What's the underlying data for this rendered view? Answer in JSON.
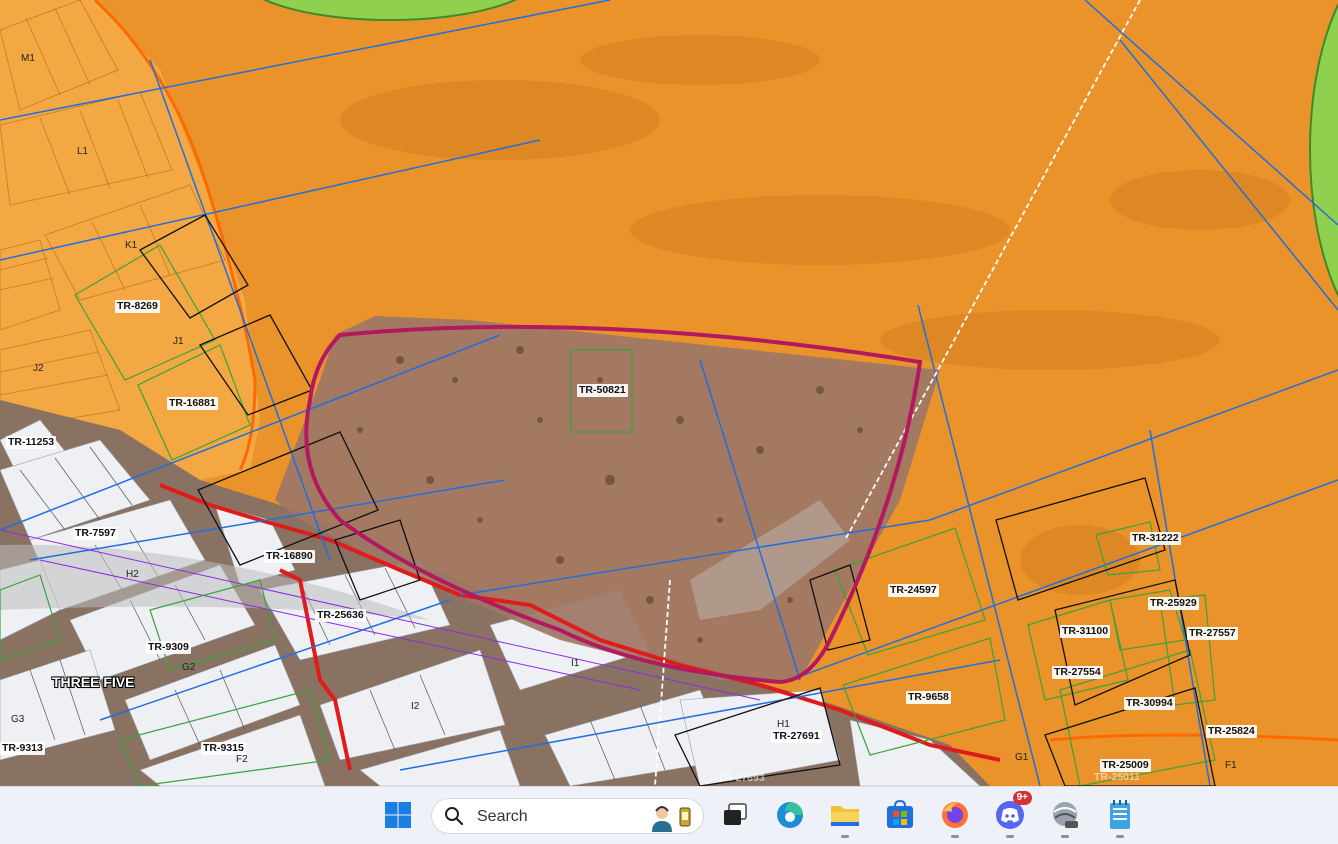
{
  "map": {
    "area_label": "THREE FIVE",
    "parcel_labels": [
      {
        "text": "M1",
        "style": "plain"
      },
      {
        "text": "L1",
        "style": "plain"
      },
      {
        "text": "K1",
        "style": "plain"
      },
      {
        "text": "J1",
        "style": "plain"
      },
      {
        "text": "J2",
        "style": "plain"
      },
      {
        "text": "TR-8269",
        "style": "box"
      },
      {
        "text": "TR-16881",
        "style": "box"
      },
      {
        "text": "TR-11253",
        "style": "box"
      },
      {
        "text": "TR-7597",
        "style": "box"
      },
      {
        "text": "TR-16890",
        "style": "box"
      },
      {
        "text": "H2",
        "style": "plain"
      },
      {
        "text": "TR-25636",
        "style": "box"
      },
      {
        "text": "TR-9309",
        "style": "box"
      },
      {
        "text": "G2",
        "style": "plain"
      },
      {
        "text": "G3",
        "style": "plain"
      },
      {
        "text": "TR-9313",
        "style": "box"
      },
      {
        "text": "TR-9315",
        "style": "box"
      },
      {
        "text": "F2",
        "style": "plain"
      },
      {
        "text": "TR-50821",
        "style": "box"
      },
      {
        "text": "I1",
        "style": "plain"
      },
      {
        "text": "I2",
        "style": "plain"
      },
      {
        "text": "H1",
        "style": "plain"
      },
      {
        "text": "TR-27691",
        "style": "box"
      },
      {
        "text": "TR-27693",
        "style": "ghost"
      },
      {
        "text": "TR-24597",
        "style": "box"
      },
      {
        "text": "TR-9658",
        "style": "box"
      },
      {
        "text": "TR-31222",
        "style": "box"
      },
      {
        "text": "TR-25929",
        "style": "box"
      },
      {
        "text": "TR-31100",
        "style": "box"
      },
      {
        "text": "TR-27557",
        "style": "box"
      },
      {
        "text": "TR-27554",
        "style": "box"
      },
      {
        "text": "TR-30994",
        "style": "box"
      },
      {
        "text": "TR-25824",
        "style": "box"
      },
      {
        "text": "G1",
        "style": "plain"
      },
      {
        "text": "TR-25009",
        "style": "box"
      },
      {
        "text": "TR-25011",
        "style": "ghost"
      },
      {
        "text": "F1",
        "style": "plain"
      }
    ],
    "colors": {
      "zone_orange": "#e9932a",
      "lot_orange": "#f4a747",
      "green_zone": "#8fd14f",
      "blue_line": "#1f6fe0",
      "parcel_green": "#3aa33a",
      "road_red": "#e01b1b",
      "boundary_magenta": "#b3195f",
      "lot_white": "#eef0f4"
    }
  },
  "taskbar": {
    "search_placeholder": "Search",
    "discord_badge": "9+",
    "apps": [
      {
        "name": "start",
        "icon": "windows-logo-icon"
      },
      {
        "name": "search",
        "icon": "search-icon"
      },
      {
        "name": "task-view",
        "icon": "task-view-icon"
      },
      {
        "name": "edge",
        "icon": "edge-browser-icon"
      },
      {
        "name": "file-explorer",
        "icon": "folder-icon"
      },
      {
        "name": "store",
        "icon": "store-icon"
      },
      {
        "name": "firefox",
        "icon": "firefox-icon"
      },
      {
        "name": "discord",
        "icon": "discord-icon"
      },
      {
        "name": "arcgis-pro",
        "icon": "arcgis-pro-icon"
      },
      {
        "name": "notepad",
        "icon": "notepad-icon"
      }
    ]
  }
}
